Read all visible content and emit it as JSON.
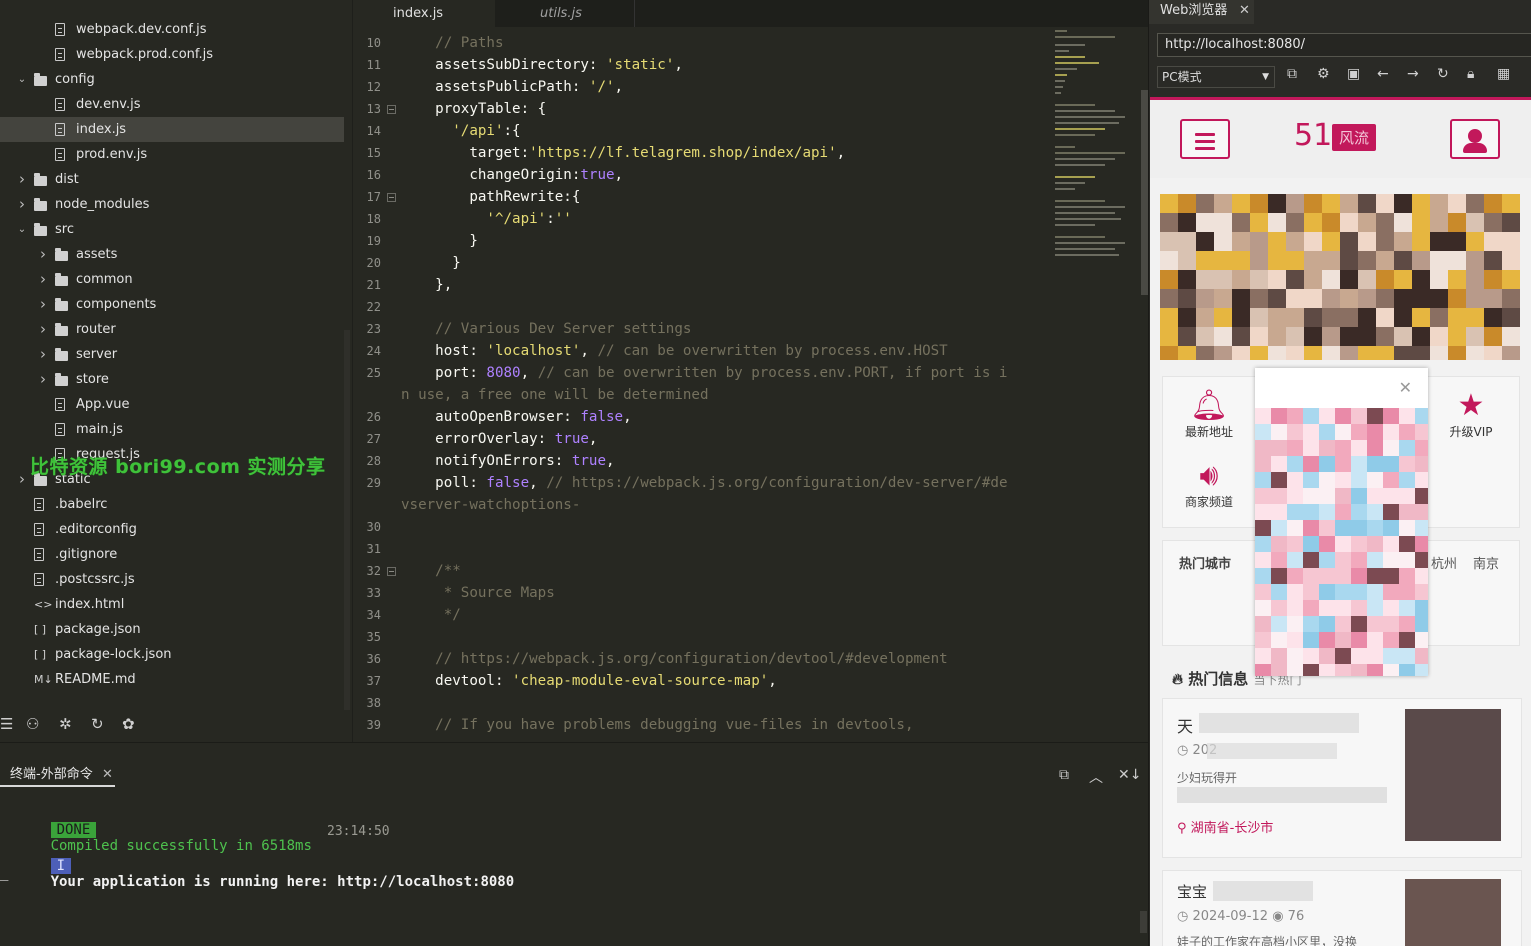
{
  "explorer": {
    "items": [
      {
        "label": "webpack.dev.conf.js",
        "depth": 2,
        "kind": "file"
      },
      {
        "label": "webpack.prod.conf.js",
        "depth": 2,
        "kind": "file"
      },
      {
        "label": "config",
        "depth": 1,
        "kind": "folder-open"
      },
      {
        "label": "dev.env.js",
        "depth": 2,
        "kind": "file"
      },
      {
        "label": "index.js",
        "depth": 2,
        "kind": "file",
        "selected": true
      },
      {
        "label": "prod.env.js",
        "depth": 2,
        "kind": "file"
      },
      {
        "label": "dist",
        "depth": 1,
        "kind": "folder"
      },
      {
        "label": "node_modules",
        "depth": 1,
        "kind": "folder"
      },
      {
        "label": "src",
        "depth": 1,
        "kind": "folder-open"
      },
      {
        "label": "assets",
        "depth": 2,
        "kind": "folder"
      },
      {
        "label": "common",
        "depth": 2,
        "kind": "folder"
      },
      {
        "label": "components",
        "depth": 2,
        "kind": "folder"
      },
      {
        "label": "router",
        "depth": 2,
        "kind": "folder"
      },
      {
        "label": "server",
        "depth": 2,
        "kind": "folder"
      },
      {
        "label": "store",
        "depth": 2,
        "kind": "folder"
      },
      {
        "label": "App.vue",
        "depth": 2,
        "kind": "file"
      },
      {
        "label": "main.js",
        "depth": 2,
        "kind": "file"
      },
      {
        "label": "request.js",
        "depth": 2,
        "kind": "file"
      },
      {
        "label": "static",
        "depth": 1,
        "kind": "folder"
      },
      {
        "label": ".babelrc",
        "depth": 1,
        "kind": "file-plain"
      },
      {
        "label": ".editorconfig",
        "depth": 1,
        "kind": "file-plain"
      },
      {
        "label": ".gitignore",
        "depth": 1,
        "kind": "file-plain"
      },
      {
        "label": ".postcssrc.js",
        "depth": 1,
        "kind": "file"
      },
      {
        "label": "index.html",
        "depth": 1,
        "kind": "html"
      },
      {
        "label": "package.json",
        "depth": 1,
        "kind": "json"
      },
      {
        "label": "package-lock.json",
        "depth": 1,
        "kind": "json"
      },
      {
        "label": "README.md",
        "depth": 1,
        "kind": "md"
      }
    ],
    "glyphs": {
      "html": "<>",
      "json": "[ ]",
      "md": "M↓"
    },
    "watermark": "比特资源 bori99.com 实测分享"
  },
  "editor": {
    "tabs": [
      "index.js",
      "utils.js"
    ],
    "lines": [
      {
        "n": "10",
        "fold": false,
        "parts": [
          [
            "c-com",
            "    // Paths"
          ]
        ]
      },
      {
        "n": "11",
        "fold": false,
        "parts": [
          [
            "c-key",
            "    assetsSubDirectory: "
          ],
          [
            "c-str",
            "'static'"
          ],
          [
            "c-key",
            ","
          ]
        ]
      },
      {
        "n": "12",
        "fold": false,
        "parts": [
          [
            "c-key",
            "    assetsPublicPath: "
          ],
          [
            "c-str",
            "'/'"
          ],
          [
            "c-key",
            ","
          ]
        ]
      },
      {
        "n": "13",
        "fold": true,
        "parts": [
          [
            "c-key",
            "    proxyTable: {"
          ]
        ]
      },
      {
        "n": "14",
        "fold": false,
        "parts": [
          [
            "c-key",
            "      "
          ],
          [
            "c-str",
            "'/api'"
          ],
          [
            "c-key",
            ":{"
          ]
        ]
      },
      {
        "n": "15",
        "fold": false,
        "parts": [
          [
            "c-key",
            "        target:"
          ],
          [
            "c-str",
            "'https://lf.telagrem.shop/index/api'"
          ],
          [
            "c-key",
            ","
          ]
        ]
      },
      {
        "n": "16",
        "fold": false,
        "parts": [
          [
            "c-key",
            "        changeOrigin:"
          ],
          [
            "c-bool",
            "true"
          ],
          [
            "c-key",
            ","
          ]
        ]
      },
      {
        "n": "17",
        "fold": true,
        "parts": [
          [
            "c-key",
            "        pathRewrite:{"
          ]
        ]
      },
      {
        "n": "18",
        "fold": false,
        "parts": [
          [
            "c-key",
            "          "
          ],
          [
            "c-str",
            "'^/api'"
          ],
          [
            "c-key",
            ":"
          ],
          [
            "c-str",
            "''"
          ]
        ]
      },
      {
        "n": "19",
        "fold": false,
        "parts": [
          [
            "c-key",
            "        }"
          ]
        ]
      },
      {
        "n": "20",
        "fold": false,
        "parts": [
          [
            "c-key",
            "      }"
          ]
        ]
      },
      {
        "n": "21",
        "fold": false,
        "parts": [
          [
            "c-key",
            "    },"
          ]
        ]
      },
      {
        "n": "22",
        "fold": false,
        "parts": [
          [
            "c-key",
            ""
          ]
        ]
      },
      {
        "n": "23",
        "fold": false,
        "parts": [
          [
            "c-com",
            "    // Various Dev Server settings"
          ]
        ]
      },
      {
        "n": "24",
        "fold": false,
        "parts": [
          [
            "c-key",
            "    host: "
          ],
          [
            "c-str",
            "'localhost'"
          ],
          [
            "c-key",
            ", "
          ],
          [
            "c-com",
            "// can be overwritten by process.env.HOST"
          ]
        ]
      },
      {
        "n": "25",
        "fold": false,
        "parts": [
          [
            "c-key",
            "    port: "
          ],
          [
            "c-bool",
            "8080"
          ],
          [
            "c-key",
            ", "
          ],
          [
            "c-com",
            "// can be overwritten by process.env.PORT, if port is i"
          ]
        ]
      },
      {
        "n": "",
        "fold": false,
        "parts": [
          [
            "c-com",
            "n use, a free one will be determined"
          ]
        ]
      },
      {
        "n": "26",
        "fold": false,
        "parts": [
          [
            "c-key",
            "    autoOpenBrowser: "
          ],
          [
            "c-bool",
            "false"
          ],
          [
            "c-key",
            ","
          ]
        ]
      },
      {
        "n": "27",
        "fold": false,
        "parts": [
          [
            "c-key",
            "    errorOverlay: "
          ],
          [
            "c-bool",
            "true"
          ],
          [
            "c-key",
            ","
          ]
        ]
      },
      {
        "n": "28",
        "fold": false,
        "parts": [
          [
            "c-key",
            "    notifyOnErrors: "
          ],
          [
            "c-bool",
            "true"
          ],
          [
            "c-key",
            ","
          ]
        ]
      },
      {
        "n": "29",
        "fold": false,
        "parts": [
          [
            "c-key",
            "    poll: "
          ],
          [
            "c-bool",
            "false"
          ],
          [
            "c-key",
            ", "
          ],
          [
            "c-com",
            "// https://webpack.js.org/configuration/dev-server/#de"
          ]
        ]
      },
      {
        "n": "",
        "fold": false,
        "parts": [
          [
            "c-com",
            "vserver-watchoptions-"
          ]
        ]
      },
      {
        "n": "30",
        "fold": false,
        "parts": [
          [
            "c-key",
            ""
          ]
        ]
      },
      {
        "n": "31",
        "fold": false,
        "parts": [
          [
            "c-key",
            ""
          ]
        ]
      },
      {
        "n": "32",
        "fold": true,
        "parts": [
          [
            "c-com",
            "    /**"
          ]
        ]
      },
      {
        "n": "33",
        "fold": false,
        "parts": [
          [
            "c-com",
            "     * Source Maps"
          ]
        ]
      },
      {
        "n": "34",
        "fold": false,
        "parts": [
          [
            "c-com",
            "     */"
          ]
        ]
      },
      {
        "n": "35",
        "fold": false,
        "parts": [
          [
            "c-key",
            ""
          ]
        ]
      },
      {
        "n": "36",
        "fold": false,
        "parts": [
          [
            "c-com",
            "    // https://webpack.js.org/configuration/devtool/#development"
          ]
        ]
      },
      {
        "n": "37",
        "fold": false,
        "parts": [
          [
            "c-key",
            "    devtool: "
          ],
          [
            "c-str",
            "'cheap-module-eval-source-map'"
          ],
          [
            "c-key",
            ","
          ]
        ]
      },
      {
        "n": "38",
        "fold": false,
        "parts": [
          [
            "c-key",
            ""
          ]
        ]
      },
      {
        "n": "39",
        "fold": false,
        "parts": [
          [
            "c-com",
            "    // If you have problems debugging vue-files in devtools,"
          ]
        ]
      }
    ]
  },
  "terminal": {
    "tab_label": "终端-外部命令",
    "done_badge": "DONE",
    "done_text": "Compiled successfully in 6518ms",
    "time": "23:14:50",
    "info_badge": "I",
    "info_text": "Your application is running here: http://localhost:8080",
    "cursor": "_"
  },
  "browser": {
    "title": "Web浏览器",
    "url": "http://localhost:8080/",
    "mode": "PC模式",
    "site": {
      "logo_num": "51",
      "logo_tag": "风流",
      "categories": [
        "最新地址",
        "升级VIP",
        "商家频道"
      ],
      "hot_city_label": "热门城市",
      "cities": [
        "杭州",
        "南京"
      ],
      "hot_info_label": "热门信息",
      "hot_info_sub": "当下热门",
      "card1": {
        "title": "天",
        "date": "202",
        "desc": "少妇玩得开",
        "location": "湖南省-长沙市"
      },
      "card2": {
        "title": "宝宝",
        "date": "2024-09-12",
        "views": "76",
        "desc": "娃子的工作家在高档小区里，没换"
      }
    },
    "colors": {
      "accent": "#c2185b"
    }
  }
}
